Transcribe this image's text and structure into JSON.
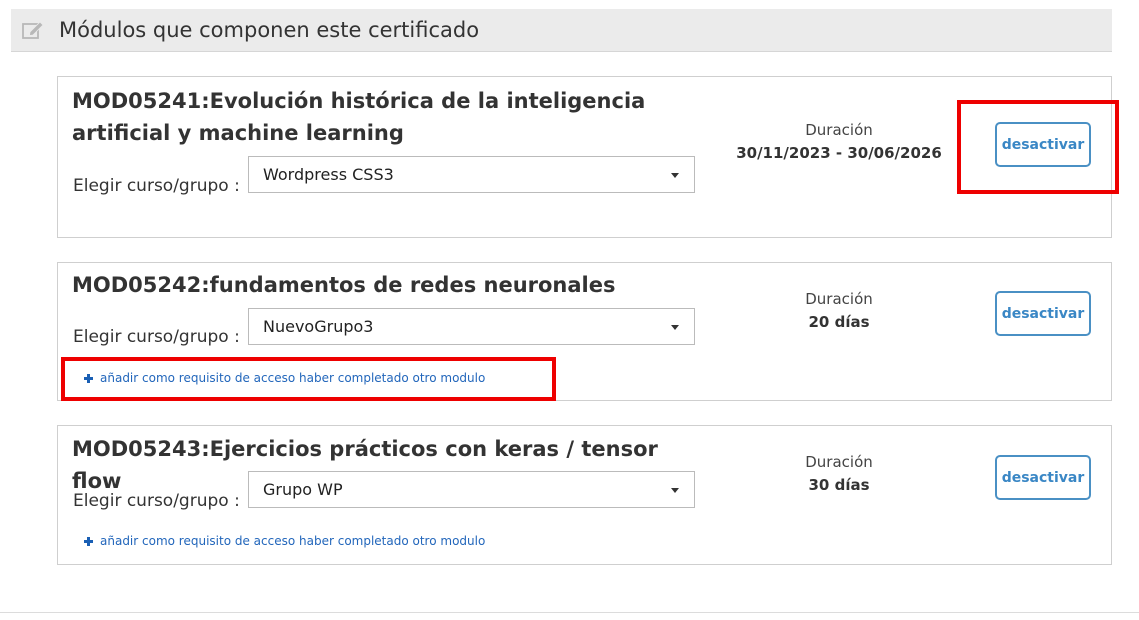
{
  "header": {
    "title": "Módulos que componen este certificado",
    "icon": "edit-icon"
  },
  "modules": [
    {
      "code_title": "MOD05241:Evolución histórica de la inteligencia artificial y machine learning",
      "choose_label": "Elegir curso/grupo :",
      "selected_group": "Wordpress CSS3",
      "duration_label": "Duración",
      "duration_value": "30/11/2023 - 30/06/2026",
      "deactivate_label": "desactivar"
    },
    {
      "code_title": "MOD05242:fundamentos de redes neuronales",
      "choose_label": "Elegir curso/grupo :",
      "selected_group": "NuevoGrupo3",
      "duration_label": "Duración",
      "duration_value": "20 días",
      "deactivate_label": "desactivar",
      "add_requirement_label": "añadir como requisito de acceso haber completado otro modulo"
    },
    {
      "code_title": "MOD05243:Ejercicios prácticos con keras / tensor flow",
      "choose_label": "Elegir curso/grupo :",
      "selected_group": "Grupo WP",
      "duration_label": "Duración",
      "duration_value": "30 días",
      "deactivate_label": "desactivar",
      "add_requirement_label": "añadir como requisito de acceso haber completado otro modulo"
    }
  ],
  "colors": {
    "accent": "#3a87c5",
    "link": "#2266bb",
    "highlight": "#ee0000"
  }
}
